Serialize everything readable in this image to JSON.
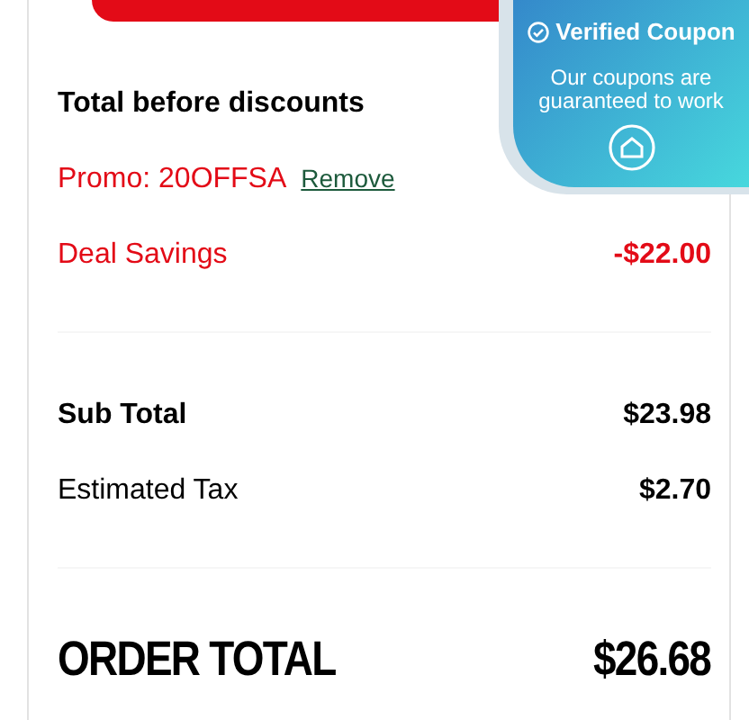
{
  "checkout_button": {
    "kind": "cut-off"
  },
  "coupon_badge": {
    "title": "Verified Coupon",
    "message": "Our coupons are guaranteed to work"
  },
  "summary": [
    {
      "kind": "bold",
      "label": "Total before discounts"
    },
    {
      "kind": "promo",
      "label": "Promo: 20OFFSA",
      "link": "Remove"
    },
    {
      "kind": "discount",
      "label": "Deal Savings",
      "amount": "-$22.00"
    },
    {
      "kind": "divider"
    },
    {
      "kind": "bold",
      "label": "Sub Total",
      "amount": "$23.98"
    },
    {
      "kind": "plain",
      "label": "Estimated Tax",
      "amount": "$2.70"
    },
    {
      "kind": "divider"
    },
    {
      "kind": "total",
      "label": "ORDER TOTAL",
      "amount": "$26.68"
    }
  ]
}
